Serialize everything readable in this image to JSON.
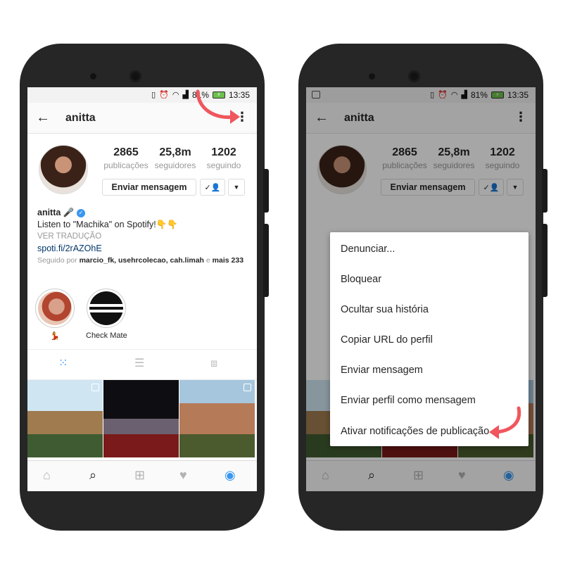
{
  "status": {
    "battery": "81%",
    "time": "13:35"
  },
  "profile": {
    "username": "anitta",
    "stats": [
      {
        "value": "2865",
        "label": "publicações"
      },
      {
        "value": "25,8m",
        "label": "seguidores"
      },
      {
        "value": "1202",
        "label": "seguindo"
      }
    ],
    "message_button": "Enviar mensagem",
    "name": "anitta",
    "name_emoji": "🎤",
    "bio": "Listen to \"Machika\" on Spotify!👇👇",
    "translate": "VER TRADUÇÃO",
    "link": "spoti.fi/2rAZOhE",
    "followed_by_prefix": "Seguido por",
    "followed_by_names": "marcio_fk, usehrcolecao, cah.limah",
    "followed_by_and": "e",
    "followed_by_more": "mais 233"
  },
  "highlights": [
    {
      "label": "💃"
    },
    {
      "label": "Check Mate"
    }
  ],
  "menu": {
    "items": [
      "Denunciar...",
      "Bloquear",
      "Ocultar sua história",
      "Copiar URL do perfil",
      "Enviar mensagem",
      "Enviar perfil como mensagem",
      "Ativar notificações de publicação"
    ]
  },
  "icons": {
    "back": "arrow-left-icon",
    "more": "kebab-icon",
    "grid": "grid-icon",
    "list": "list-icon",
    "tagged": "tagged-icon",
    "home": "home-icon",
    "search": "search-icon",
    "add": "add-icon",
    "heart": "heart-icon",
    "profile": "profile-icon"
  },
  "colors": {
    "accent": "#3897f0",
    "arrow": "#f0565d",
    "phone": "#262626"
  }
}
